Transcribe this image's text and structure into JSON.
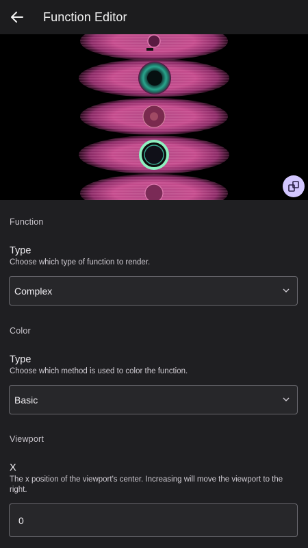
{
  "appbar": {
    "title": "Function Editor",
    "back_icon": "arrow-back-icon"
  },
  "preview": {
    "description_icon": "swap-icon",
    "accent": "#d3c7ff"
  },
  "sections": {
    "function": {
      "header": "Function",
      "type_title": "Type",
      "type_desc": "Choose which type of function to render.",
      "type_value": "Complex"
    },
    "color": {
      "header": "Color",
      "type_title": "Type",
      "type_desc": "Choose which method is used to color the function.",
      "type_value": "Basic"
    },
    "viewport": {
      "header": "Viewport",
      "x_title": "X",
      "x_desc": "The x position of the viewport's center. Increasing will move the viewport to the right.",
      "x_value": "0"
    }
  }
}
